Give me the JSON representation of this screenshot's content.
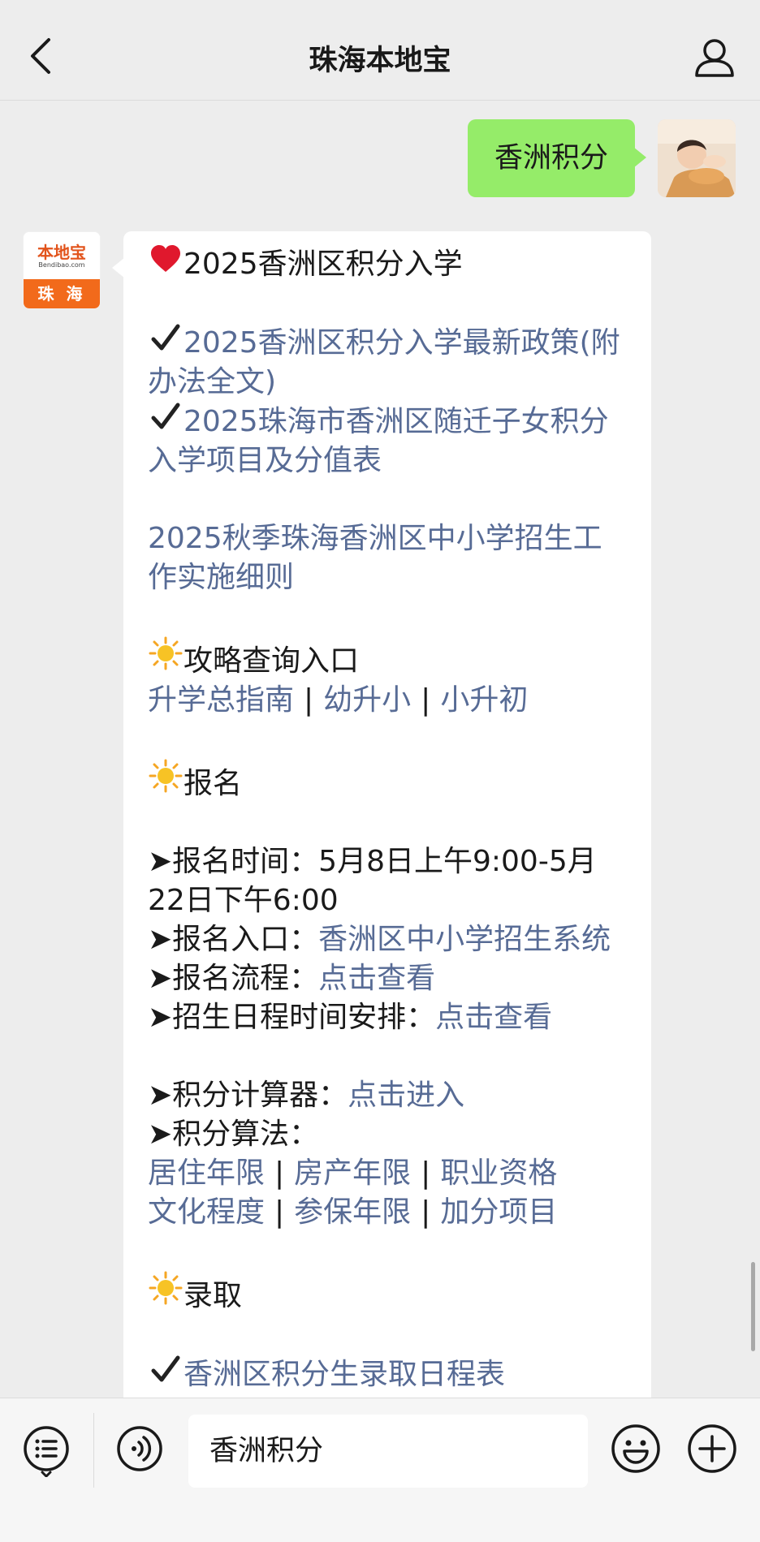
{
  "header": {
    "title": "珠海本地宝"
  },
  "user_message": {
    "text": "香洲积分"
  },
  "bot": {
    "logo_text": "本地宝",
    "logo_sub": "Bendibao.com",
    "logo_city": "珠 海"
  },
  "bot_message": {
    "heading": "2025香洲区积分入学",
    "policy_1": "2025香洲区积分入学最新政策(附办法全文)",
    "policy_2": "2025珠海市香洲区随迁子女积分入学项目及分值表",
    "rules_link": "2025秋季珠海香洲区中小学招生工作实施细则",
    "guide_heading": "攻略查询入口",
    "guide_links": [
      "升学总指南",
      "幼升小",
      "小升初"
    ],
    "signup_heading": "报名",
    "signup_time_label": "➤报名时间：",
    "signup_time_value": "5月8日上午9:00-5月22日下午6:00",
    "signup_entry_label": "➤报名入口：",
    "signup_entry_link": "香洲区中小学招生系统",
    "signup_flow_label": "➤报名流程：",
    "signup_flow_link": "点击查看",
    "schedule_label": "➤招生日程时间安排：",
    "schedule_link": "点击查看",
    "calculator_label": "➤积分计算器：",
    "calculator_link": "点击进入",
    "algorithm_label": "➤积分算法：",
    "algorithm_row1": [
      "居住年限",
      "房产年限",
      "职业资格"
    ],
    "algorithm_row2": [
      "文化程度",
      "参保年限",
      "加分项目"
    ],
    "admit_heading": "录取",
    "admit_link": "香洲区积分生录取日程表"
  },
  "input_bar": {
    "value": "香洲积分"
  },
  "colors": {
    "link": "#576b95",
    "bubble_me": "#95ec69",
    "bubble_bot": "#ffffff",
    "background": "#ededed"
  }
}
